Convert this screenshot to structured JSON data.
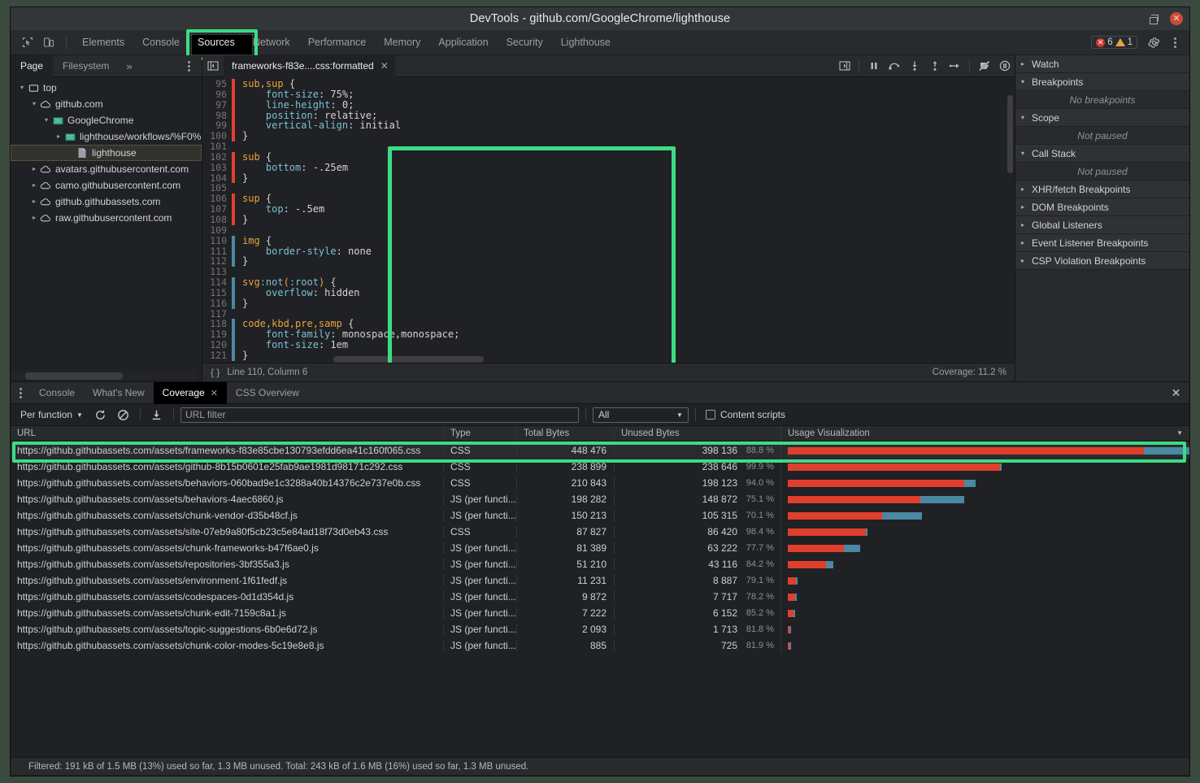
{
  "window": {
    "title": "DevTools - github.com/GoogleChrome/lighthouse",
    "restore_icon": "restore-icon",
    "close_icon": "close-icon"
  },
  "main_tabs": {
    "inspect_icon": "inspect-cursor-icon",
    "device_icon": "device-toolbar-icon",
    "items": [
      {
        "label": "Elements"
      },
      {
        "label": "Console"
      },
      {
        "label": "Sources"
      },
      {
        "label": "Network"
      },
      {
        "label": "Performance"
      },
      {
        "label": "Memory"
      },
      {
        "label": "Application"
      },
      {
        "label": "Security"
      },
      {
        "label": "Lighthouse"
      }
    ],
    "selected": "Sources",
    "errors_count": "6",
    "warnings_count": "1",
    "gear_icon": "gear-icon",
    "kebab_icon": "more-options-icon"
  },
  "navigator": {
    "tabs": [
      {
        "label": "Page"
      },
      {
        "label": "Filesystem"
      }
    ],
    "more_label": "»",
    "selected": "Page",
    "kebab_icon": "more-options-icon",
    "tree": [
      {
        "label": "top",
        "depth": 0,
        "twist": "▾",
        "icon": "frame-icon",
        "selected": false
      },
      {
        "label": "github.com",
        "depth": 1,
        "twist": "▾",
        "icon": "cloud-icon",
        "selected": false
      },
      {
        "label": "GoogleChrome",
        "depth": 2,
        "twist": "▾",
        "icon": "folder-icon",
        "selected": false
      },
      {
        "label": "lighthouse/workflows/%F0%",
        "depth": 3,
        "twist": "▸",
        "icon": "folder-icon",
        "selected": false
      },
      {
        "label": "lighthouse",
        "depth": 4,
        "twist": "",
        "icon": "document-icon",
        "selected": true
      },
      {
        "label": "avatars.githubusercontent.com",
        "depth": 1,
        "twist": "▸",
        "icon": "cloud-icon",
        "selected": false
      },
      {
        "label": "camo.githubusercontent.com",
        "depth": 1,
        "twist": "▸",
        "icon": "cloud-icon",
        "selected": false
      },
      {
        "label": "github.githubassets.com",
        "depth": 1,
        "twist": "▸",
        "icon": "cloud-icon",
        "selected": false
      },
      {
        "label": "raw.githubusercontent.com",
        "depth": 1,
        "twist": "▸",
        "icon": "cloud-icon",
        "selected": false
      }
    ]
  },
  "editor": {
    "panel_toggle_icon": "show-navigator-icon",
    "tab_label": "frameworks-f83e....css:formatted",
    "tab_close_icon": "close-icon",
    "debug_buttons": [
      {
        "icon": "show-debugger-sidebar-icon"
      },
      {
        "icon": "pause-script-icon"
      },
      {
        "icon": "step-over-icon"
      },
      {
        "icon": "step-into-icon"
      },
      {
        "icon": "step-out-icon"
      },
      {
        "icon": "step-icon"
      },
      {
        "icon": "deactivate-breakpoints-icon"
      },
      {
        "icon": "pause-on-exceptions-icon"
      }
    ],
    "status_left": "Line 110, Column 6",
    "status_right": "Coverage: 11.2 %",
    "status_icon": "pretty-print-braces-icon",
    "lines": [
      {
        "n": "95",
        "cov": "unused",
        "text": "sub,sup {"
      },
      {
        "n": "96",
        "cov": "unused",
        "text": "    font-size: 75%;"
      },
      {
        "n": "97",
        "cov": "unused",
        "text": "    line-height: 0;"
      },
      {
        "n": "98",
        "cov": "unused",
        "text": "    position: relative;"
      },
      {
        "n": "99",
        "cov": "unused",
        "text": "    vertical-align: initial"
      },
      {
        "n": "100",
        "cov": "unused",
        "text": "}"
      },
      {
        "n": "101",
        "cov": "none",
        "text": ""
      },
      {
        "n": "102",
        "cov": "unused",
        "text": "sub {"
      },
      {
        "n": "103",
        "cov": "unused",
        "text": "    bottom: -.25em"
      },
      {
        "n": "104",
        "cov": "unused",
        "text": "}"
      },
      {
        "n": "105",
        "cov": "none",
        "text": ""
      },
      {
        "n": "106",
        "cov": "unused",
        "text": "sup {"
      },
      {
        "n": "107",
        "cov": "unused",
        "text": "    top: -.5em"
      },
      {
        "n": "108",
        "cov": "unused",
        "text": "}"
      },
      {
        "n": "109",
        "cov": "none",
        "text": ""
      },
      {
        "n": "110",
        "cov": "used",
        "text": "img {"
      },
      {
        "n": "111",
        "cov": "used",
        "text": "    border-style: none"
      },
      {
        "n": "112",
        "cov": "used",
        "text": "}"
      },
      {
        "n": "113",
        "cov": "none",
        "text": ""
      },
      {
        "n": "114",
        "cov": "used",
        "text": "svg:not(:root) {"
      },
      {
        "n": "115",
        "cov": "used",
        "text": "    overflow: hidden"
      },
      {
        "n": "116",
        "cov": "used",
        "text": "}"
      },
      {
        "n": "117",
        "cov": "none",
        "text": ""
      },
      {
        "n": "118",
        "cov": "used",
        "text": "code,kbd,pre,samp {"
      },
      {
        "n": "119",
        "cov": "used",
        "text": "    font-family: monospace,monospace;"
      },
      {
        "n": "120",
        "cov": "used",
        "text": "    font-size: 1em"
      },
      {
        "n": "121",
        "cov": "used",
        "text": "}"
      }
    ]
  },
  "debugger_sidebar": {
    "sections": [
      {
        "title": "Watch",
        "expanded": false,
        "body": null
      },
      {
        "title": "Breakpoints",
        "expanded": true,
        "body": "No breakpoints"
      },
      {
        "title": "Scope",
        "expanded": true,
        "body": "Not paused"
      },
      {
        "title": "Call Stack",
        "expanded": true,
        "body": "Not paused"
      },
      {
        "title": "XHR/fetch Breakpoints",
        "expanded": false,
        "body": null
      },
      {
        "title": "DOM Breakpoints",
        "expanded": false,
        "body": null
      },
      {
        "title": "Global Listeners",
        "expanded": false,
        "body": null
      },
      {
        "title": "Event Listener Breakpoints",
        "expanded": false,
        "body": null
      },
      {
        "title": "CSP Violation Breakpoints",
        "expanded": false,
        "body": null
      }
    ]
  },
  "drawer": {
    "kebab_icon": "more-tools-icon",
    "tabs": [
      {
        "label": "Console",
        "closable": false
      },
      {
        "label": "What's New",
        "closable": false
      },
      {
        "label": "Coverage",
        "closable": true
      },
      {
        "label": "CSS Overview",
        "closable": false
      }
    ],
    "selected": "Coverage",
    "close_icon": "close-drawer-icon"
  },
  "coverage": {
    "mode_label": "Per function",
    "reload_icon": "reload-icon",
    "clear_icon": "clear-icon",
    "export_icon": "export-icon",
    "filter_placeholder": "URL filter",
    "filter_value": "",
    "type_filter_value": "All",
    "content_scripts_label": "Content scripts",
    "content_scripts_checked": false,
    "columns": [
      "URL",
      "Type",
      "Total Bytes",
      "Unused Bytes",
      "Usage Visualization"
    ],
    "rows": [
      {
        "url": "https://github.githubassets.com/assets/frameworks-f83e85cbe130793efdd6ea41c160f065.css",
        "type": "CSS",
        "total": "448 476",
        "unused": "398 136",
        "pct": "88.8 %",
        "unused_w": 87.5,
        "used_w": 11.2,
        "selected": true
      },
      {
        "url": "https://github.githubassets.com/assets/github-8b15b0601e25fab9ae1981d98171c292.css",
        "type": "CSS",
        "total": "238 899",
        "unused": "238 646",
        "pct": "99.9 %",
        "unused_w": 52.1,
        "used_w": 0.3,
        "selected": false
      },
      {
        "url": "https://github.githubassets.com/assets/behaviors-060bad9e1c3288a40b14376c2e737e0b.css",
        "type": "CSS",
        "total": "210 843",
        "unused": "198 123",
        "pct": "94.0 %",
        "unused_w": 43.4,
        "used_w": 2.8,
        "selected": false
      },
      {
        "url": "https://github.githubassets.com/assets/behaviors-4aec6860.js",
        "type": "JS (per functi...",
        "total": "198 282",
        "unused": "148 872",
        "pct": "75.1 %",
        "unused_w": 32.6,
        "used_w": 10.8,
        "selected": false
      },
      {
        "url": "https://github.githubassets.com/assets/chunk-vendor-d35b48cf.js",
        "type": "JS (per functi...",
        "total": "150 213",
        "unused": "105 315",
        "pct": "70.1 %",
        "unused_w": 23.1,
        "used_w": 9.8,
        "selected": false
      },
      {
        "url": "https://github.githubassets.com/assets/site-07eb9a80f5cb23c5e84ad18f73d0eb43.css",
        "type": "CSS",
        "total": "87 827",
        "unused": "86 420",
        "pct": "98.4 %",
        "unused_w": 19.2,
        "used_w": 0.3,
        "selected": false
      },
      {
        "url": "https://github.githubassets.com/assets/chunk-frameworks-b47f6ae0.js",
        "type": "JS (per functi...",
        "total": "81 389",
        "unused": "63 222",
        "pct": "77.7 %",
        "unused_w": 13.8,
        "used_w": 4.0,
        "selected": false
      },
      {
        "url": "https://github.githubassets.com/assets/repositories-3bf355a3.js",
        "type": "JS (per functi...",
        "total": "51 210",
        "unused": "43 116",
        "pct": "84.2 %",
        "unused_w": 9.4,
        "used_w": 1.8,
        "selected": false
      },
      {
        "url": "https://github.githubassets.com/assets/environment-1f61fedf.js",
        "type": "JS (per functi...",
        "total": "11 231",
        "unused": "8 887",
        "pct": "79.1 %",
        "unused_w": 1.9,
        "used_w": 0.5,
        "selected": false
      },
      {
        "url": "https://github.githubassets.com/assets/codespaces-0d1d354d.js",
        "type": "JS (per functi...",
        "total": "9 872",
        "unused": "7 717",
        "pct": "78.2 %",
        "unused_w": 1.7,
        "used_w": 0.5,
        "selected": false
      },
      {
        "url": "https://github.githubassets.com/assets/chunk-edit-7159c8a1.js",
        "type": "JS (per functi...",
        "total": "7 222",
        "unused": "6 152",
        "pct": "85.2 %",
        "unused_w": 1.3,
        "used_w": 0.3,
        "selected": false
      },
      {
        "url": "https://github.githubassets.com/assets/topic-suggestions-6b0e6d72.js",
        "type": "JS (per functi...",
        "total": "2 093",
        "unused": "1 713",
        "pct": "81.8 %",
        "unused_w": 0.4,
        "used_w": 0.1,
        "selected": false
      },
      {
        "url": "https://github.githubassets.com/assets/chunk-color-modes-5c19e8e8.js",
        "type": "JS (per functi...",
        "total": "885",
        "unused": "725",
        "pct": "81.9 %",
        "unused_w": 0.3,
        "used_w": 0.1,
        "selected": false
      }
    ],
    "footer": "Filtered: 191 kB of 1.5 MB (13%) used so far, 1.3 MB unused. Total: 243 kB of 1.6 MB (16%) used so far, 1.3 MB unused."
  },
  "annotations": {
    "highlight_color": "#3ddc84",
    "targets": [
      "sources-tab",
      "code-region",
      "first-coverage-row"
    ]
  }
}
